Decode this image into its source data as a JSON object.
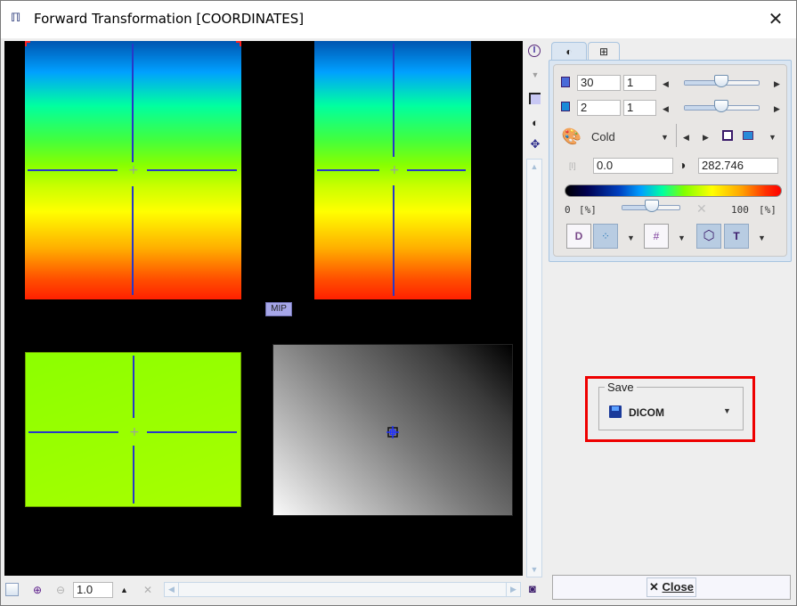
{
  "window": {
    "title": "Forward Transformation [COORDINATES]",
    "app_icon": "pmod-logo-icon",
    "close_icon": "close-icon"
  },
  "viewport": {
    "mip_label": "MIP",
    "images": [
      {
        "name": "coronal-view",
        "colormap": "Cold"
      },
      {
        "name": "sagittal-view",
        "colormap": "Cold"
      },
      {
        "name": "axial-view",
        "colormap": "Cold"
      },
      {
        "name": "mip-view",
        "colormap": "Gray"
      }
    ]
  },
  "side_tools": [
    "info-icon",
    "dropdown-arrow-icon",
    "frame-icon",
    "contrast-icon",
    "crosshair-icon"
  ],
  "tabs": [
    {
      "label": "◐",
      "icon": "contrast-tab-icon",
      "active": true
    },
    {
      "label": "⊞",
      "icon": "layout-tab-icon",
      "active": false
    }
  ],
  "controls": {
    "slice": {
      "value": "30",
      "step": "1",
      "slider_fraction": 0.5
    },
    "frame": {
      "value": "2",
      "step": "1",
      "slider_fraction": 0.5
    },
    "colortable": {
      "value": "Cold"
    },
    "min_value": "0.0",
    "max_value": "282.746",
    "colorbar_min_label": "0",
    "colorbar_max_label": "100",
    "unit_label": "[%]",
    "threshold_slider_fraction": 0.45
  },
  "save": {
    "legend": "Save",
    "format": "DICOM"
  },
  "bottom": {
    "zoom_value": "1.0",
    "close_label": "Close"
  },
  "colors": {
    "crosshair": "#2838c8",
    "highlight_box": "#ee0000",
    "panel_border": "#a8c4e0"
  }
}
